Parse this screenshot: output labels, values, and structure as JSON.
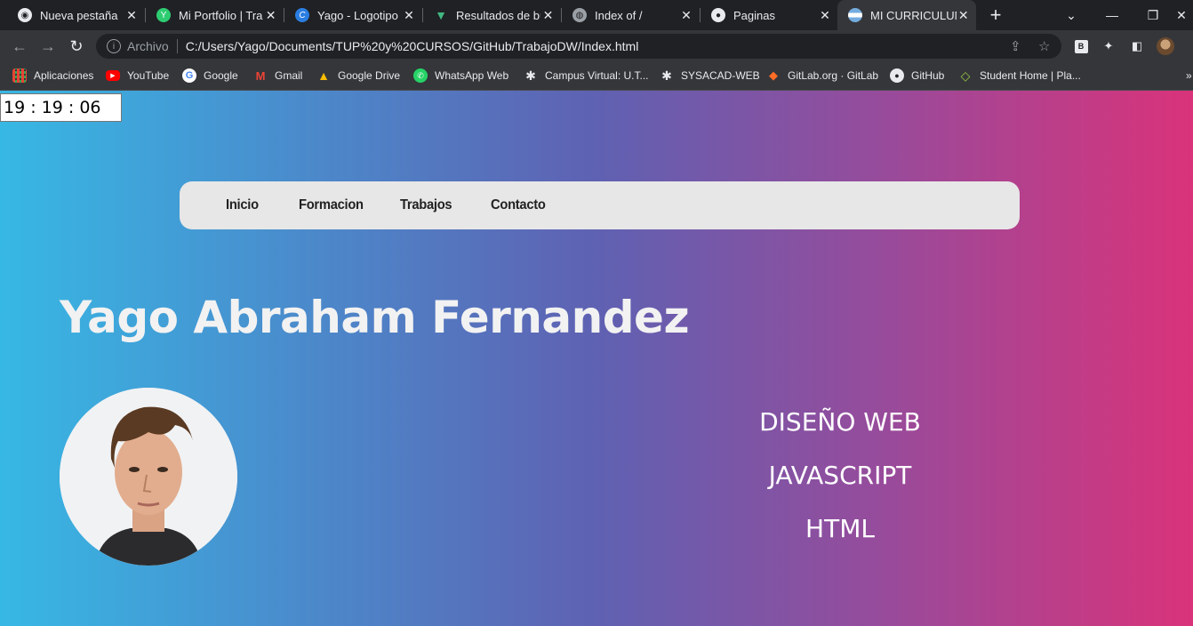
{
  "browser": {
    "tabs": [
      {
        "title": "Nueva pestaña",
        "icon": "chrome-icon",
        "active": false
      },
      {
        "title": "Mi Portfolio | Trab",
        "icon": "portfolio-icon",
        "active": false
      },
      {
        "title": "Yago - Logotipo",
        "icon": "canva-icon",
        "active": false
      },
      {
        "title": "Resultados de bú",
        "icon": "search-results-icon",
        "active": false
      },
      {
        "title": "Index of /",
        "icon": "globe-icon",
        "active": false
      },
      {
        "title": "Paginas",
        "icon": "github-icon",
        "active": false
      },
      {
        "title": "MI CURRICULUM",
        "icon": "flag-icon",
        "active": true
      }
    ],
    "address": {
      "chip": "Archivo",
      "url": "C:/Users/Yago/Documents/TUP%20y%20CURSOS/GitHub/TrabajoDW/Index.html"
    },
    "bookmarks": [
      {
        "label": "Aplicaciones",
        "icon": "apps-grid-icon"
      },
      {
        "label": "YouTube",
        "icon": "youtube-icon"
      },
      {
        "label": "Google",
        "icon": "google-icon"
      },
      {
        "label": "Gmail",
        "icon": "gmail-icon"
      },
      {
        "label": "Google Drive",
        "icon": "google-drive-icon"
      },
      {
        "label": "WhatsApp Web",
        "icon": "whatsapp-icon"
      },
      {
        "label": "Campus Virtual: U.T...",
        "icon": "utn-icon"
      },
      {
        "label": "SYSACAD-WEB",
        "icon": "utn-icon"
      },
      {
        "label": "GitLab.org · GitLab",
        "icon": "gitlab-icon"
      },
      {
        "label": "GitHub",
        "icon": "github-icon"
      },
      {
        "label": "Student Home | Pla...",
        "icon": "platzi-icon"
      }
    ]
  },
  "page": {
    "clock": "19 : 19 : 06",
    "nav": [
      "Inicio",
      "Formacion",
      "Trabajos",
      "Contacto"
    ],
    "name": "Yago Abraham Fernandez",
    "skills": [
      "DISEÑO WEB",
      "JAVASCRIPT",
      "HTML"
    ]
  },
  "colors": {
    "gradient_start": "#37b8e4",
    "gradient_mid": "#5f61b2",
    "gradient_end": "#d9337a",
    "navbar_bg": "#e7e7e7"
  }
}
